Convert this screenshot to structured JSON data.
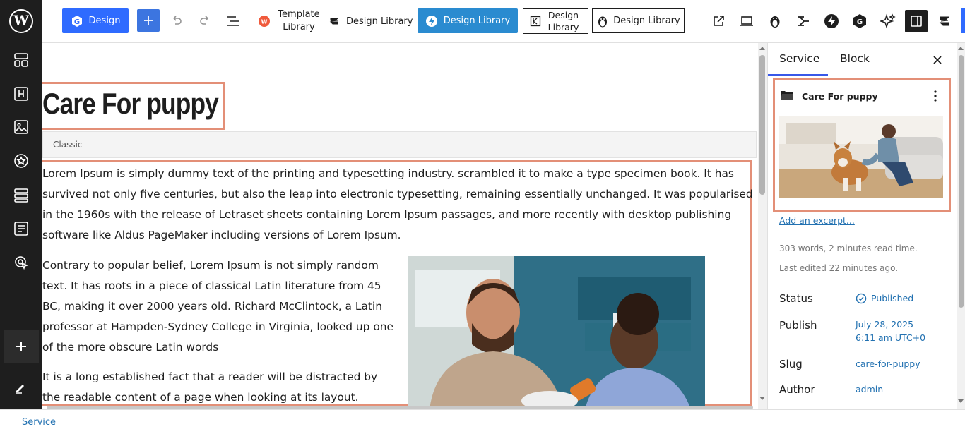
{
  "app": {
    "logo": "W"
  },
  "rail": {
    "items": [
      "patterns-icon",
      "heading-icon",
      "image-icon",
      "star-icon",
      "layout-icon",
      "list-icon",
      "cursor-icon"
    ],
    "add_label": "+",
    "edit_icon": "pencil-icon"
  },
  "toolbar": {
    "design_label": "Design",
    "add_label": "+",
    "template_library_label": "Template Library",
    "design_library_1": "Design Library",
    "design_library_2": "Design Library",
    "design_library_3": "Design Library",
    "design_library_4": "Design Library"
  },
  "document": {
    "title": "Care For puppy",
    "classic_label": "Classic",
    "paragraph_1": "Lorem Ipsum is simply dummy text of the printing and typesetting industry. scrambled it to make a type specimen book. It has survived not only five centuries, but also the leap into electronic typesetting, remaining essentially unchanged. It was popularised in the 1960s with the release of Letraset sheets containing Lorem Ipsum passages, and more recently with desktop publishing software like Aldus PageMaker including versions of Lorem Ipsum.",
    "paragraph_2": "Contrary to popular belief, Lorem Ipsum is not simply random text. It has roots in a piece of classical Latin literature from 45 BC, making it over 2000 years old. Richard McClintock, a Latin professor at Hampden-Sydney College in Virginia, looked up one of the more obscure Latin words",
    "paragraph_3": "It is a long established fact that a reader will be distracted by the readable content of a page when looking at its layout."
  },
  "panel": {
    "tabs": [
      "Service",
      "Block"
    ],
    "card_title": "Care For puppy",
    "excerpt_link": "Add an excerpt...",
    "word_count": "303 words, 2 minutes read time.",
    "last_edited": "Last edited 22 minutes ago.",
    "rows": {
      "status_label": "Status",
      "status_value": "Published",
      "publish_label": "Publish",
      "publish_date": "July 28, 2025",
      "publish_time": "6:11 am UTC+0",
      "slug_label": "Slug",
      "slug_value": "care-for-puppy",
      "author_label": "Author",
      "author_value": "admin"
    }
  },
  "footer": {
    "breadcrumb": "Service"
  },
  "colors": {
    "accent": "#2f6bff",
    "highlight_border": "#e38f77",
    "link": "#2271b1",
    "rail_bg": "#1e1e1e"
  }
}
